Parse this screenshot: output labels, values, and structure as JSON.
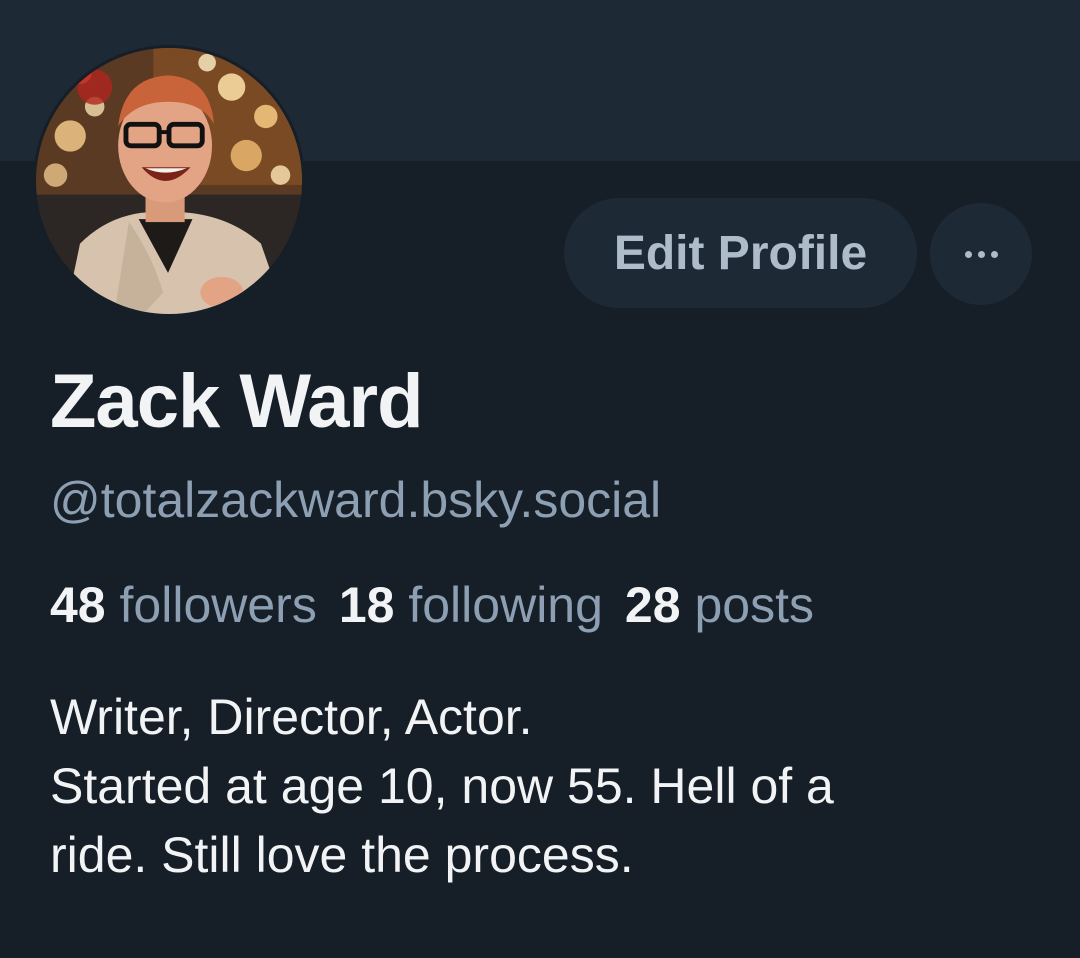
{
  "profile": {
    "display_name": "Zack Ward",
    "handle": "@totalzackward.bsky.social",
    "avatar_icon": "profile-photo",
    "bio_lines": [
      "Writer, Director, Actor.",
      "Started at age 10, now 55. Hell of a",
      "ride. Still love the process."
    ]
  },
  "actions": {
    "edit_label": "Edit Profile",
    "more_icon": "ellipsis-icon"
  },
  "stats": {
    "followers": {
      "count": "48",
      "label": "followers"
    },
    "following": {
      "count": "18",
      "label": "following"
    },
    "posts": {
      "count": "28",
      "label": "posts"
    }
  },
  "colors": {
    "background": "#161e27",
    "banner": "#1e2936",
    "button_bg": "#1e2936",
    "button_text": "#aebbc9",
    "primary_text": "#f1f3f5",
    "secondary_text": "#8d9fb2"
  }
}
